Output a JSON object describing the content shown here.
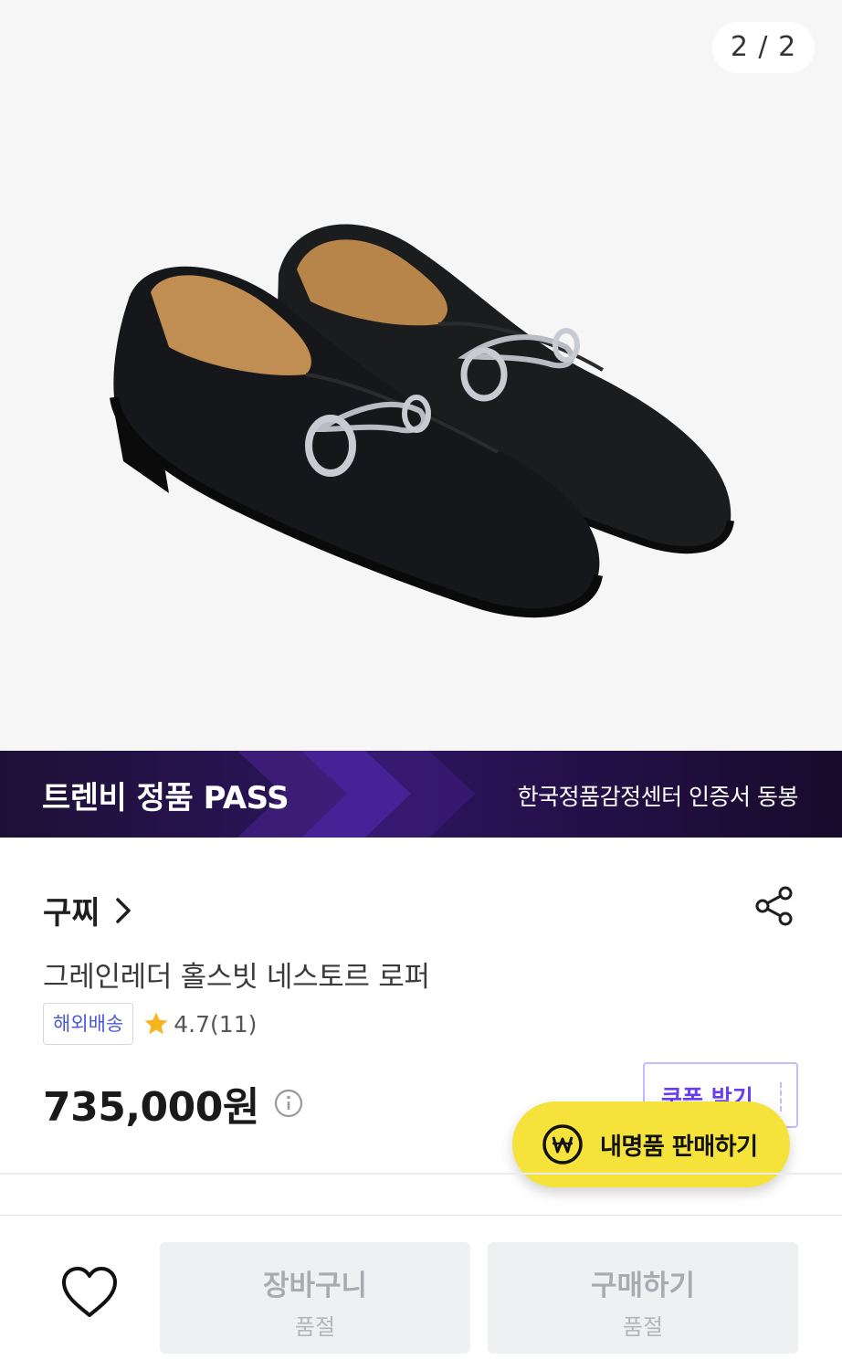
{
  "gallery": {
    "counter": "2 / 2",
    "image_alt": "black leather horsebit loafers"
  },
  "pass_banner": {
    "title": "트렌비 정품 PASS",
    "subtitle": "한국정품감정센터 인증서 동봉"
  },
  "product": {
    "brand": "구찌",
    "name": "그레인레더 홀스빗 네스토르 로퍼",
    "shipping_badge": "해외배송",
    "rating": "4.7(11)",
    "price": "735,000원",
    "coupon_label": "쿠폰 받기",
    "sell_button_label": "내명품 판매하기"
  },
  "bottom_bar": {
    "cart": {
      "label": "장바구니",
      "status": "품절"
    },
    "buy": {
      "label": "구매하기",
      "status": "품절"
    }
  },
  "colors": {
    "banner_bg": "#2d1560",
    "coupon_accent": "#6a3cf0",
    "sell_button_bg": "#f5e23a",
    "shipping_badge_text": "#4a5ad6",
    "star": "#f6b51e",
    "disabled_button_bg": "#eff0f2"
  },
  "icons": [
    "chevron-right-icon",
    "share-icon",
    "star-icon",
    "info-icon",
    "won-icon",
    "heart-icon"
  ]
}
